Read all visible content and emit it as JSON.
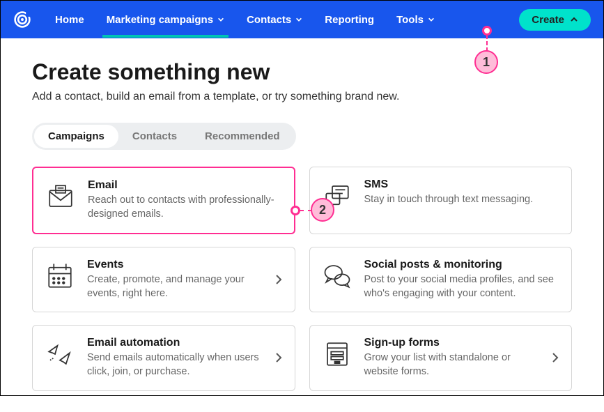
{
  "nav": {
    "items": [
      {
        "label": "Home"
      },
      {
        "label": "Marketing campaigns"
      },
      {
        "label": "Contacts"
      },
      {
        "label": "Reporting"
      },
      {
        "label": "Tools"
      }
    ],
    "create_label": "Create"
  },
  "page": {
    "title": "Create something new",
    "subtitle": "Add a contact, build an email from a template, or try something brand new."
  },
  "tabs": [
    {
      "label": "Campaigns"
    },
    {
      "label": "Contacts"
    },
    {
      "label": "Recommended"
    }
  ],
  "cards": [
    {
      "title": "Email",
      "desc": "Reach out to contacts with professionally-designed emails."
    },
    {
      "title": "SMS",
      "desc": "Stay in touch through text messaging."
    },
    {
      "title": "Events",
      "desc": "Create, promote, and manage your events, right here."
    },
    {
      "title": "Social posts & monitoring",
      "desc": "Post to your social media profiles, and see who's engaging with your content."
    },
    {
      "title": "Email automation",
      "desc": "Send emails automatically when users click, join, or purchase."
    },
    {
      "title": "Sign-up forms",
      "desc": "Grow your list with standalone or website forms."
    }
  ],
  "markers": {
    "m1": "1",
    "m2": "2"
  }
}
